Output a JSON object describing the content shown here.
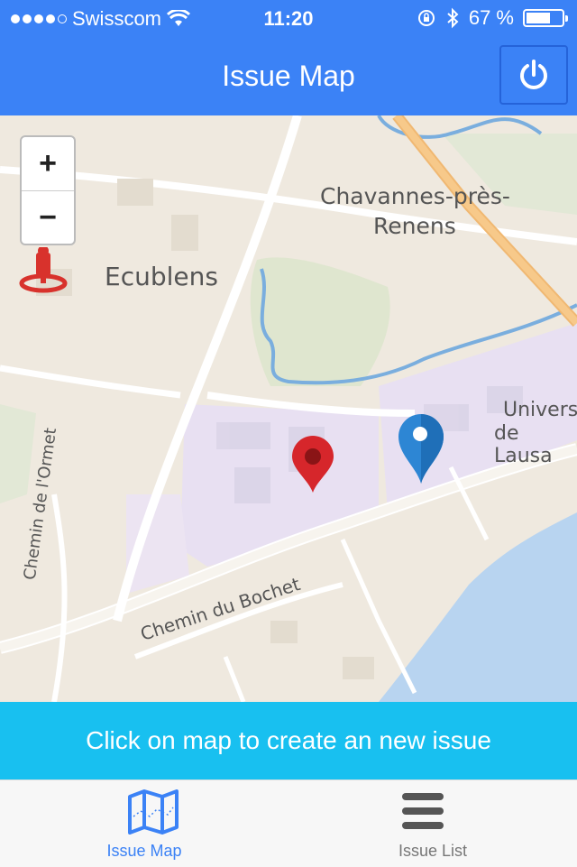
{
  "status": {
    "carrier": "Swisscom",
    "time": "11:20",
    "battery": "67 %"
  },
  "header": {
    "title": "Issue Map",
    "power_icon": "power-icon"
  },
  "map": {
    "zoom_in": "+",
    "zoom_out": "−",
    "labels": {
      "ecublens": "Ecublens",
      "chavannes_1": "Chavannes-près-",
      "chavannes_2": "Renens",
      "univ_1": "Univers",
      "univ_2": "de Lausa",
      "ormet": "Chemin de l'Ormet",
      "bochet": "Chemin du Bochet"
    },
    "markers": [
      "red-marker",
      "blue-marker"
    ],
    "locate_icon": "locate-pin-icon"
  },
  "banner": {
    "text": "Click on map to create an new issue"
  },
  "tabs": [
    {
      "label": "Issue Map",
      "icon": "map-icon",
      "active": true
    },
    {
      "label": "Issue List",
      "icon": "list-icon",
      "active": false
    }
  ],
  "colors": {
    "primary": "#3b82f6",
    "banner": "#18c0f0",
    "water": "#b8d4f0",
    "campus": "#e8e0f2",
    "park": "#dfe6cf"
  }
}
